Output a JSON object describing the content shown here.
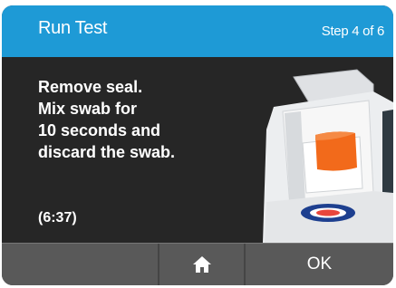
{
  "header": {
    "title": "Run Test",
    "step": "Step 4 of 6"
  },
  "instruction": {
    "lines": [
      "Remove seal.",
      "Mix swab for",
      "10 seconds and",
      "discard the swab."
    ]
  },
  "timer": "(6:37)",
  "footer": {
    "left_label": "",
    "home_icon": "home-icon",
    "ok_label": "OK"
  },
  "colors": {
    "header": "#1e9ad6",
    "content_bg": "#262626",
    "footer_bg": "#595959",
    "accent_orange": "#f26a1b",
    "label_blue": "#1d3f8f"
  }
}
